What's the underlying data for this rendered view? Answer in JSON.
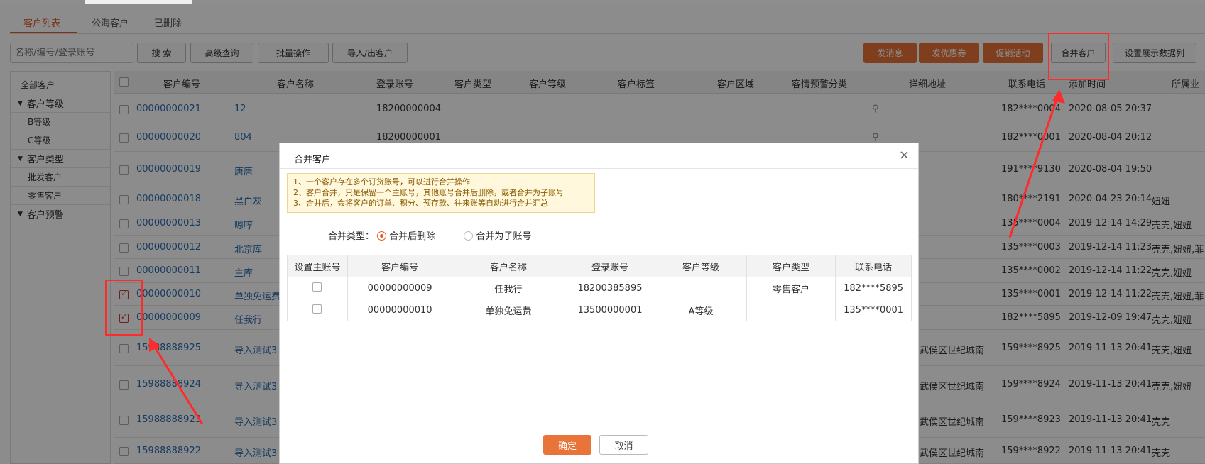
{
  "tabs": [
    "客户列表",
    "公海客户",
    "已删除"
  ],
  "search": {
    "placeholder": "名称/编号/登录账号"
  },
  "toolbar": {
    "search": "搜 索",
    "advanced": "高级查询",
    "batch": "批量操作",
    "import_export": "导入/出客户",
    "send_msg": "发消息",
    "send_coupon": "发优惠券",
    "promo": "促销活动",
    "merge": "合并客户",
    "columns": "设置展示数据列"
  },
  "sidebar": {
    "all": "全部客户",
    "level_group": "客户等级",
    "level_b": "B等级",
    "level_c": "C等级",
    "type_group": "客户类型",
    "type_wholesale": "批发客户",
    "type_retail": "零售客户",
    "warning_group": "客户预警"
  },
  "columns": [
    "客户编号",
    "客户名称",
    "登录账号",
    "客户类型",
    "客户等级",
    "客户标签",
    "客户区域",
    "客情预警分类",
    "详细地址",
    "联系电话",
    "添加时间",
    "所属业"
  ],
  "rows": [
    {
      "code": "00000000021",
      "name": "12",
      "login": "18200000004",
      "address": "",
      "phone": "182****0004",
      "time": "2020-08-05 20:37",
      "owner": ""
    },
    {
      "code": "00000000020",
      "name": "804",
      "login": "18200000001",
      "address": "",
      "phone": "182****0001",
      "time": "2020-08-04 20:12",
      "owner": ""
    },
    {
      "code": "00000000019",
      "name": "唐唐",
      "login": "",
      "address": "",
      "phone": "191****9130",
      "time": "2020-08-04 19:50",
      "owner": ""
    },
    {
      "code": "00000000018",
      "name": "黑白灰",
      "login": "",
      "address": "",
      "phone": "180****2191",
      "time": "2020-04-23 20:14",
      "owner": "妞妞"
    },
    {
      "code": "00000000013",
      "name": "嗯哼",
      "login": "",
      "address": "",
      "phone": "135****0004",
      "time": "2019-12-14 14:29",
      "owner": "壳壳,妞妞"
    },
    {
      "code": "00000000012",
      "name": "北京库",
      "login": "",
      "address": "",
      "phone": "135****0003",
      "time": "2019-12-14 11:23",
      "owner": "壳壳,妞妞,菲"
    },
    {
      "code": "00000000011",
      "name": "主库",
      "login": "",
      "address": "",
      "phone": "135****0002",
      "time": "2019-12-14 11:22",
      "owner": "壳壳,妞妞"
    },
    {
      "code": "00000000010",
      "name": "单独免运费",
      "login": "",
      "address": "",
      "phone": "135****0001",
      "time": "2019-12-14 11:22",
      "owner": "壳壳,妞妞,菲"
    },
    {
      "code": "00000000009",
      "name": "任我行",
      "login": "",
      "address": "",
      "phone": "182****5895",
      "time": "2019-12-09 19:47",
      "owner": "壳壳,妞妞"
    },
    {
      "code": "15988888925",
      "name": "导入测试3",
      "login": "",
      "address": "武侯区世纪城南",
      "phone": "159****8925",
      "time": "2019-11-13 20:41",
      "owner": "壳壳,妞妞"
    },
    {
      "code": "15988888924",
      "name": "导入测试3",
      "login": "",
      "address": "武侯区世纪城南",
      "phone": "159****8924",
      "time": "2019-11-13 20:41",
      "owner": "壳壳,妞妞"
    },
    {
      "code": "15988888923",
      "name": "导入测试3",
      "login": "",
      "address": "武侯区世纪城南",
      "phone": "159****8923",
      "time": "2019-11-13 20:41",
      "owner": "壳壳"
    },
    {
      "code": "15988888922",
      "name": "导入测试3",
      "login": "",
      "address": "武侯区世纪城南",
      "phone": "159****8922",
      "time": "2019-11-13 20:41",
      "owner": "壳壳"
    }
  ],
  "modal": {
    "title": "合并客户",
    "close": "×",
    "notice": [
      "1、一个客户存在多个订货账号，可以进行合并操作",
      "2、客户合并，只是保留一个主账号，其他账号合并后删除，或者合并为子账号",
      "3、合并后，会将客户的订单、积分、预存款、往来账等自动进行合并汇总"
    ],
    "merge_type_label": "合并类型：",
    "option_delete": "合并后删除",
    "option_sub": "合并为子账号",
    "columns": [
      "设置主账号",
      "客户编号",
      "客户名称",
      "登录账号",
      "客户等级",
      "客户类型",
      "联系电话"
    ],
    "rows": [
      {
        "code": "00000000009",
        "name": "任我行",
        "login": "18200385895",
        "level": "",
        "type": "零售客户",
        "phone": "182****5895"
      },
      {
        "code": "00000000010",
        "name": "单独免运费",
        "login": "13500000001",
        "level": "A等级",
        "type": "",
        "phone": "135****0001"
      }
    ],
    "ok": "确定",
    "cancel": "取消"
  },
  "accent_color": "#e8743a",
  "highlight_color": "#ff2a2a"
}
